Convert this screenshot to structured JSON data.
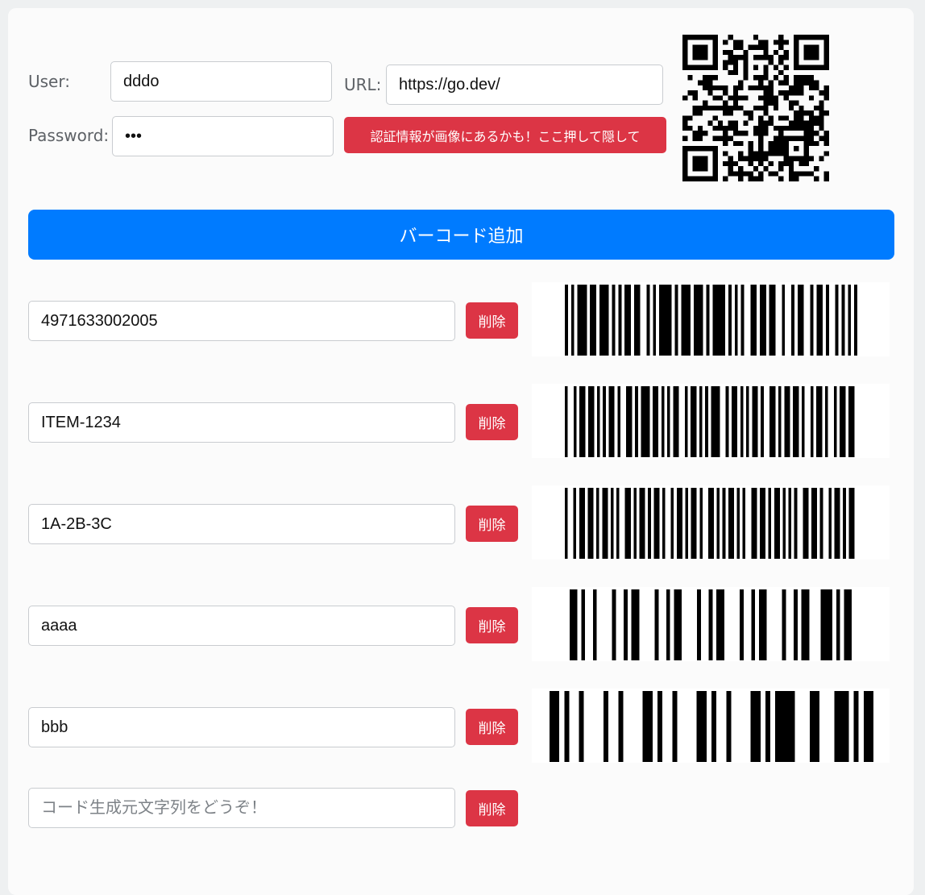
{
  "form": {
    "user_label": "User:",
    "user_value": "dddo",
    "password_label": "Password:",
    "password_value": "•••",
    "url_label": "URL:",
    "url_value": "https://go.dev/",
    "hide_button_label": "認証情報が画像にあるかも！ここ押して隠して"
  },
  "qr": {
    "encodes": "https://go.dev/",
    "icon": "qr-code"
  },
  "add_button_label": "バーコード追加",
  "delete_label": "削除",
  "rows": [
    {
      "value": "4971633002005",
      "pattern": "101011101101110101011011001010111101011101110101111010101001101101100100101100101101001010101"
    },
    {
      "value": "ITEM-1234",
      "pattern": "1001011011010101101001101011101101010110010110101011100101101010110100110101101101001011010010110110"
    },
    {
      "value": "1A-2B-3C",
      "pattern": "100101101101011010100110101101011010010110101101001101010110101001101101011010101001101101001011010110"
    },
    {
      "value": "aaaa",
      "pattern": "1101001000010010110000100101100001001011000010010110000100101100011101011"
    },
    {
      "value": "bbb",
      "pattern": "110100100001001000011010010000110100100001101011110001100011101011"
    }
  ],
  "new_row": {
    "placeholder": "コード生成元文字列をどうぞ！"
  }
}
